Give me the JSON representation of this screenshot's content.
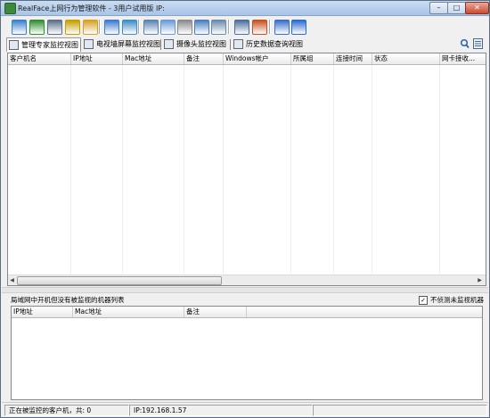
{
  "window": {
    "title": "RealFace上网行为管理软件 - 3用户试用版 IP:",
    "min_glyph": "–",
    "max_glyph": "□",
    "close_glyph": "✕"
  },
  "toolbar": {
    "buttons": [
      {
        "icon": "multi-computer-icon",
        "color": "#3a7fd0"
      },
      {
        "icon": "globe-icon",
        "color": "#2f8f2f"
      },
      {
        "icon": "monitor-screen-icon",
        "color": "#5a6f8a"
      },
      {
        "icon": "mail-icon",
        "color": "#c2a000"
      },
      {
        "icon": "users-icon",
        "color": "#d8a020"
      },
      {
        "icon": "pen-icon",
        "color": "#3c7ad0"
      },
      {
        "icon": "pin-icon",
        "color": "#3c8cc8"
      },
      {
        "icon": "display-icon",
        "color": "#5a84b0"
      },
      {
        "icon": "rotate-icon",
        "color": "#6a9ad6"
      },
      {
        "icon": "document-icon",
        "color": "#8a8a8a"
      },
      {
        "icon": "windows-icon",
        "color": "#4a7ec0"
      },
      {
        "icon": "disk-icon",
        "color": "#6a8aaa"
      },
      {
        "icon": "window-icon",
        "color": "#4c6e9c"
      },
      {
        "icon": "flag-icon",
        "color": "#c85020"
      },
      {
        "icon": "calendar-icon",
        "color": "#3a6fc8"
      },
      {
        "icon": "help-icon",
        "color": "#2a6ad0"
      }
    ]
  },
  "tabs": [
    {
      "label": "管理专家监控视图",
      "active": true
    },
    {
      "label": "电视墙屏幕监控视图",
      "active": false
    },
    {
      "label": "摄像头监控视图",
      "active": false
    },
    {
      "label": "历史数据查询视图",
      "active": false
    }
  ],
  "main_list": {
    "columns": [
      "客户机名",
      "IP地址",
      "Mac地址",
      "备注",
      "Windows帐户",
      "所属组",
      "连接时间",
      "状态",
      "网卡接收..."
    ]
  },
  "bottom_panel": {
    "title": "局域网中开机但没有被监视的机器列表",
    "checkbox_label": "不侦测未监视机器",
    "checkbox_checked": "✓",
    "columns": [
      "IP地址",
      "Mac地址",
      "备注"
    ]
  },
  "status_bar": {
    "monitored_count": "正在被监控的客户机，共: 0",
    "ip": "IP:192.168.1.57"
  }
}
